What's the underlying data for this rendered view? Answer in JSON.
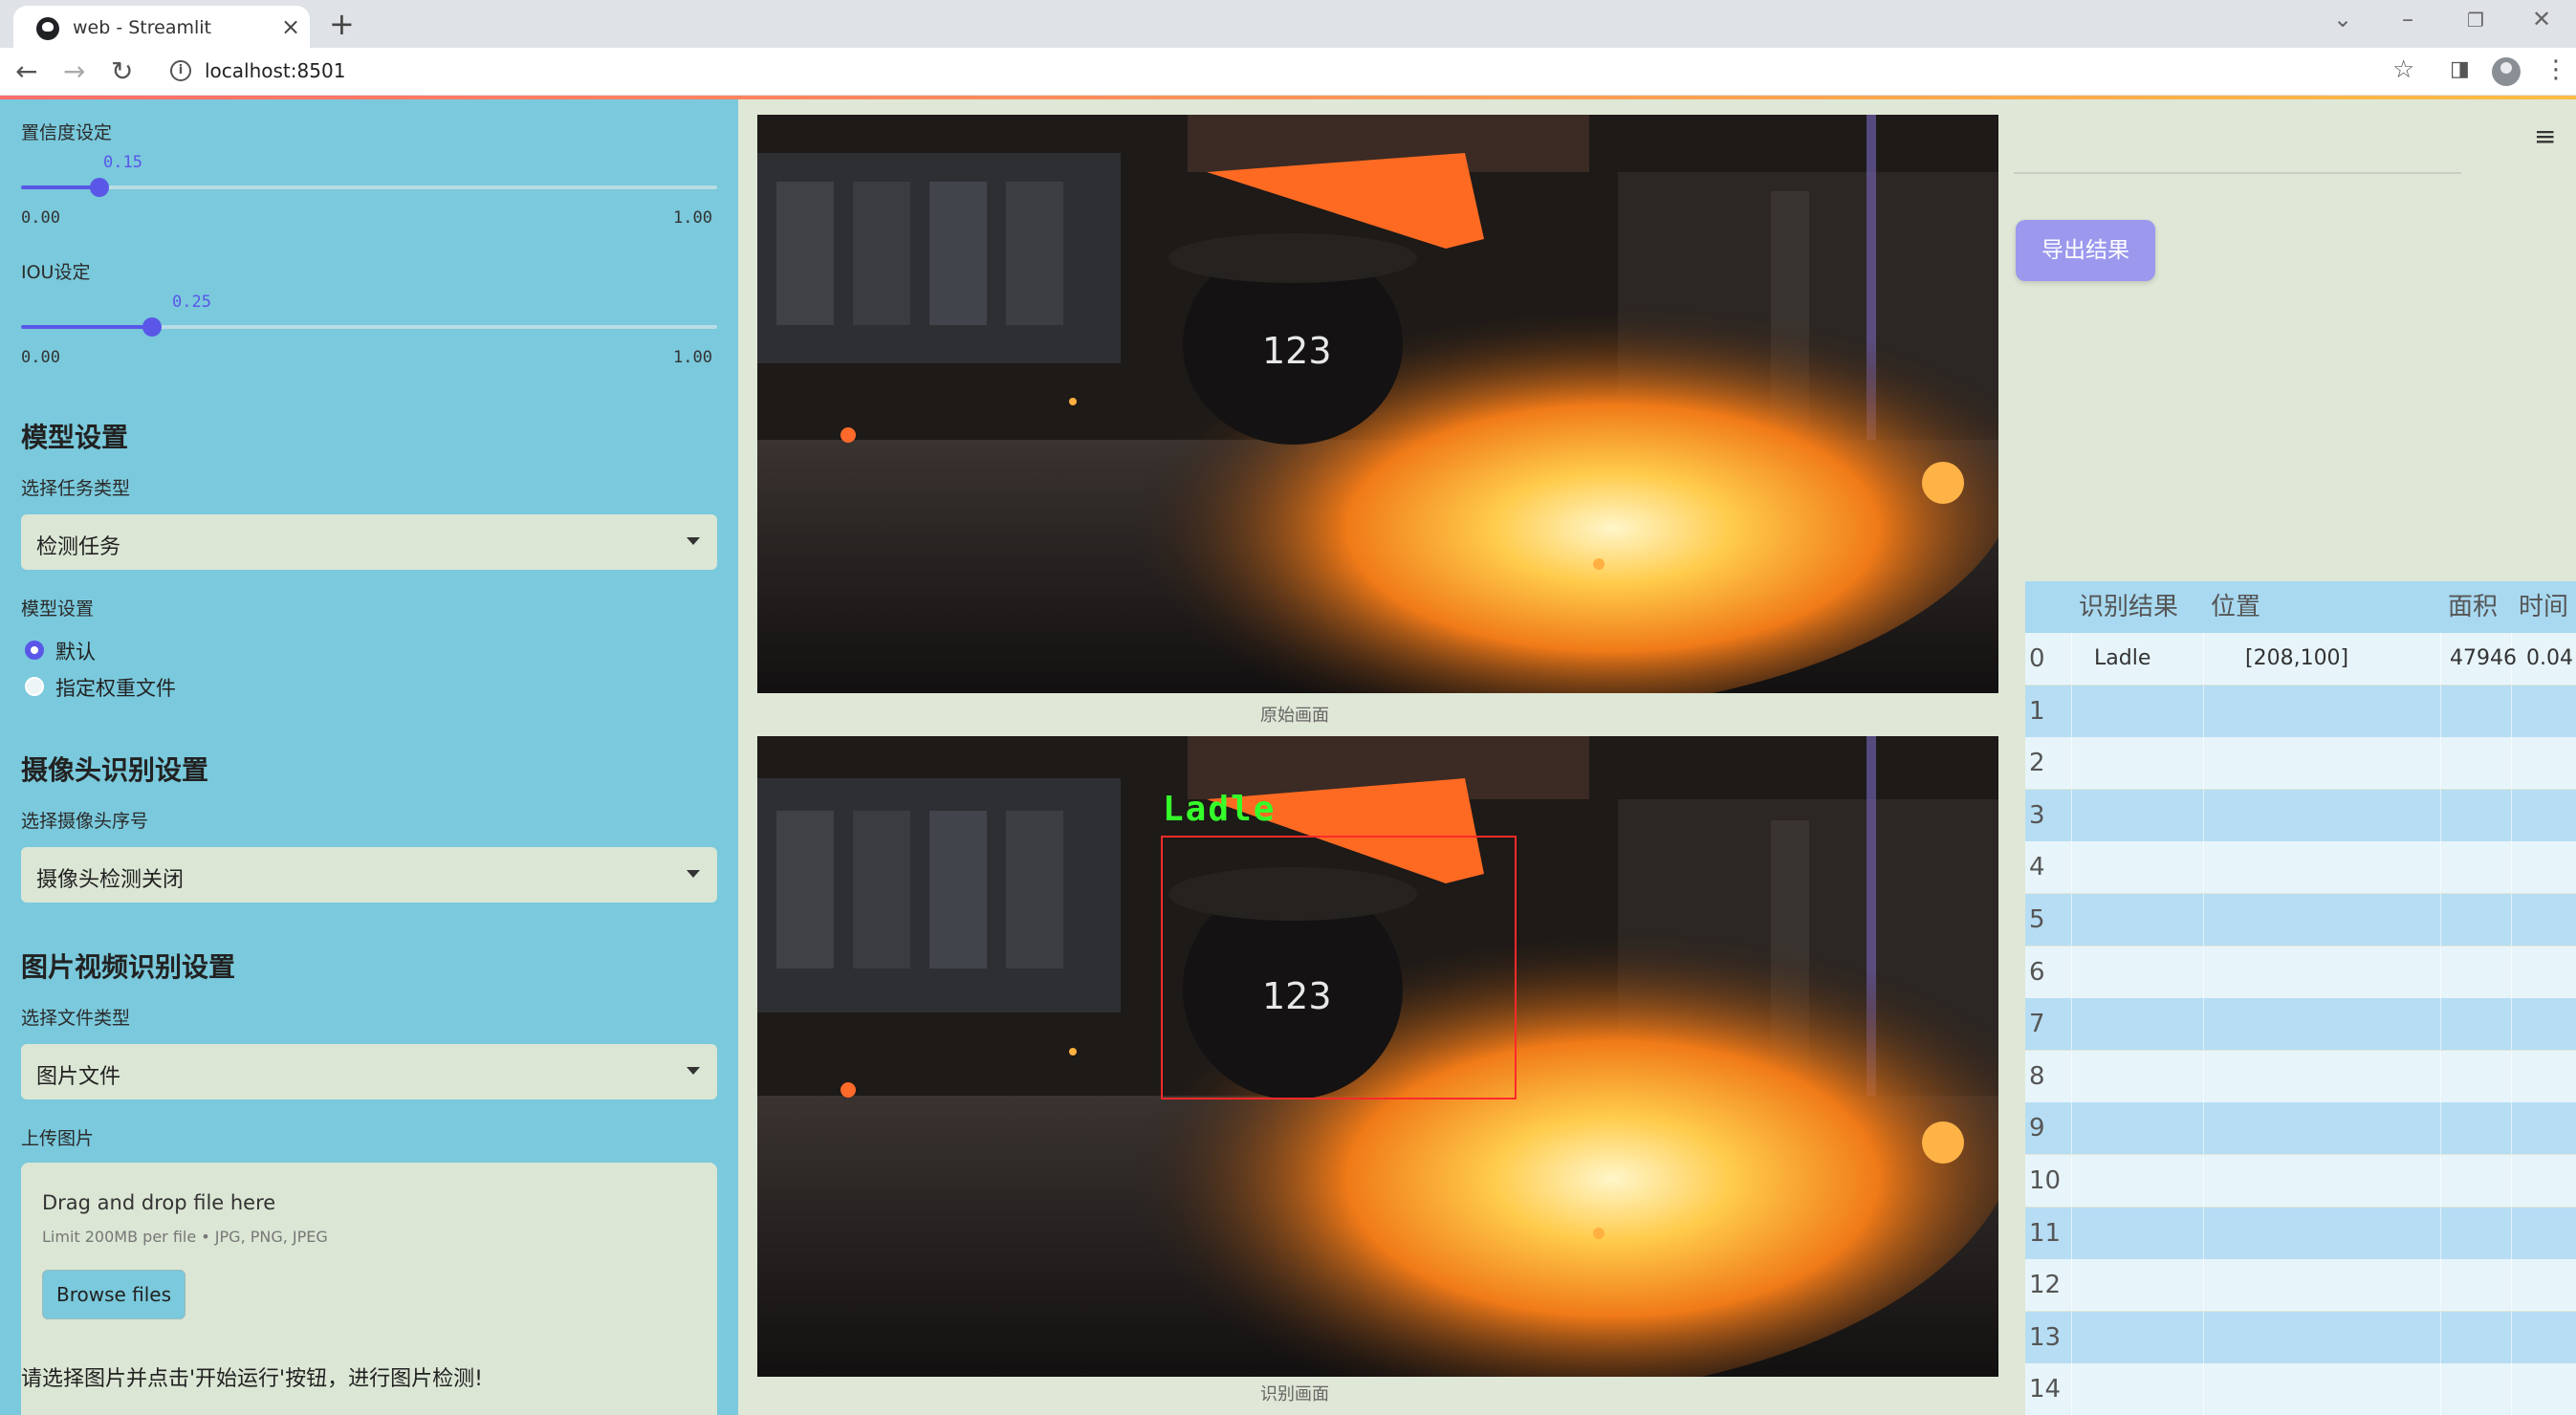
{
  "browser": {
    "tab_title": "web - Streamlit",
    "url": "localhost:8501"
  },
  "sidebar": {
    "confidence": {
      "label": "置信度设定",
      "value": "0.15",
      "min": "0.00",
      "max": "1.00",
      "fraction": 0.15
    },
    "iou": {
      "label": "IOU设定",
      "value": "0.25",
      "min": "0.00",
      "max": "1.00",
      "fraction": 0.25
    },
    "model_section": {
      "title": "模型设置",
      "task_label": "选择任务类型",
      "task_value": "检测任务",
      "weights_label": "模型设置",
      "options": [
        "默认",
        "指定权重文件"
      ],
      "selected": 0
    },
    "camera_section": {
      "title": "摄像头识别设置",
      "label": "选择摄像头序号",
      "value": "摄像头检测关闭"
    },
    "media_section": {
      "title": "图片视频识别设置",
      "filetype_label": "选择文件类型",
      "filetype_value": "图片文件",
      "upload_label": "上传图片"
    },
    "upload": {
      "title": "Drag and drop file here",
      "limit": "Limit 200MB per file • JPG, PNG, JPEG",
      "button": "Browse files"
    },
    "footer": "请选择图片并点击'开始运行'按钮，进行图片检测!"
  },
  "main": {
    "original_caption": "原始画面",
    "detected_caption": "识别画面",
    "detection_label": "Ladle",
    "ladle_number": "123"
  },
  "right": {
    "export_button": "导出结果",
    "table": {
      "headers": [
        "识别结果",
        "位置",
        "面积",
        "时间"
      ],
      "rows": [
        {
          "idx": "0",
          "result": "Ladle",
          "position": "[208,100]",
          "area": "47946",
          "time": "0.04"
        },
        {
          "idx": "1"
        },
        {
          "idx": "2"
        },
        {
          "idx": "3"
        },
        {
          "idx": "4"
        },
        {
          "idx": "5"
        },
        {
          "idx": "6"
        },
        {
          "idx": "7"
        },
        {
          "idx": "8"
        },
        {
          "idx": "9"
        },
        {
          "idx": "10"
        },
        {
          "idx": "11"
        },
        {
          "idx": "12"
        },
        {
          "idx": "13"
        },
        {
          "idx": "14"
        }
      ]
    }
  },
  "colors": {
    "sidebar": "#7ac9dc",
    "accent": "#5a57e8",
    "export_button": "#9b98ee",
    "detection_box": "#ff2a2a",
    "detection_label": "#35ff2a"
  }
}
